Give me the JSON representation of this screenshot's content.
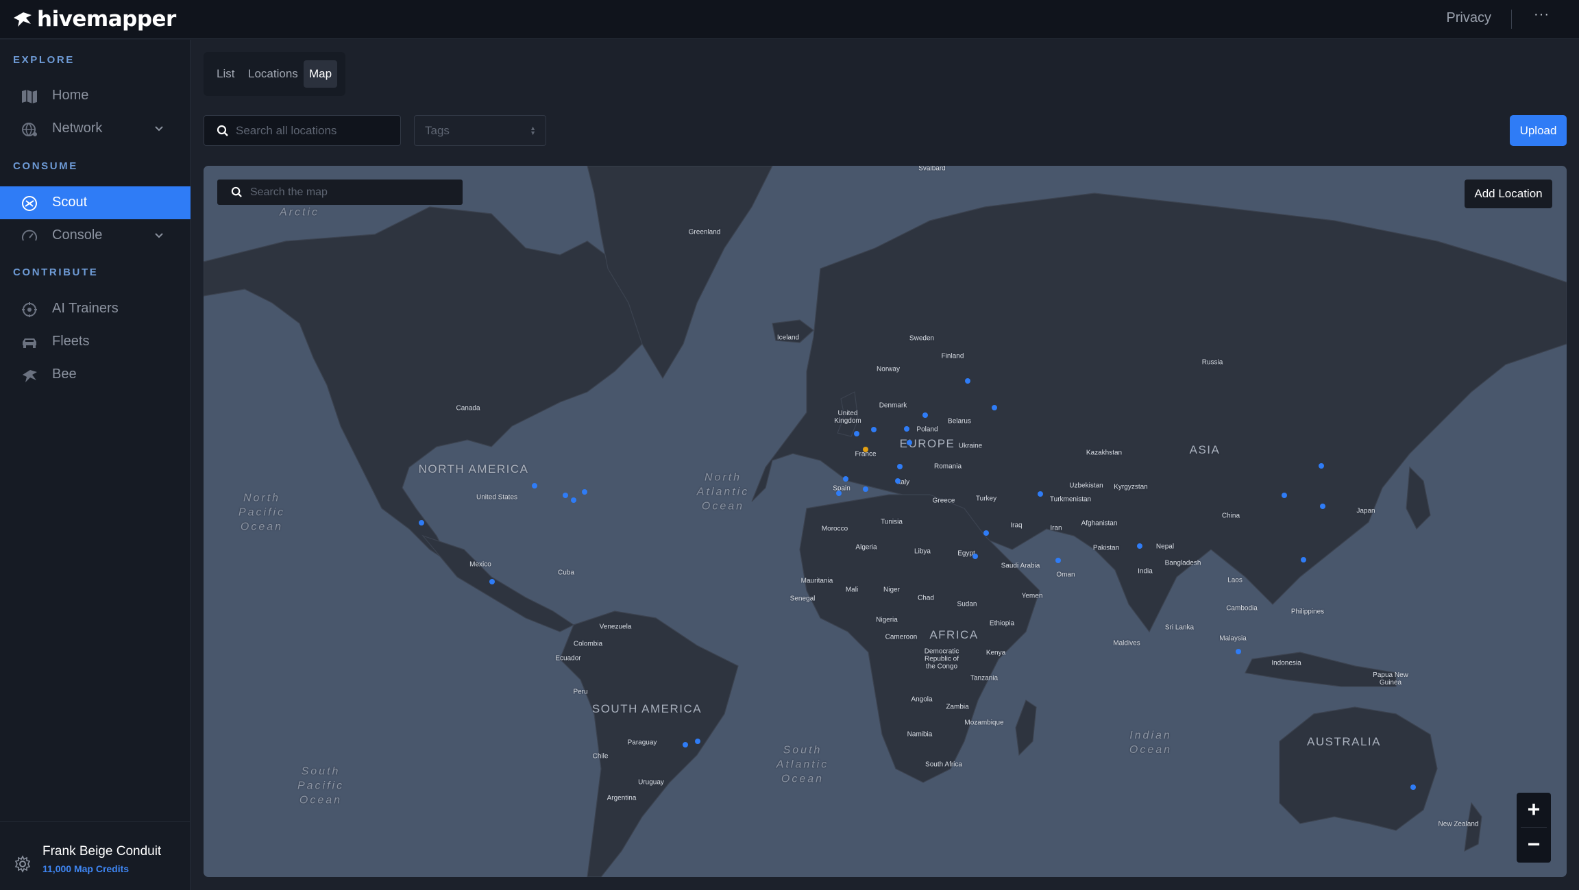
{
  "app": {
    "brand": "hivemapper"
  },
  "header": {
    "privacy_label": "Privacy",
    "more_label": "···"
  },
  "sidebar": {
    "sections": {
      "explore": "EXPLORE",
      "consume": "CONSUME",
      "contribute": "CONTRIBUTE"
    },
    "items": [
      {
        "label": "Home",
        "icon": "map-icon"
      },
      {
        "label": "Network",
        "icon": "globe-icon"
      },
      {
        "label": "Scout",
        "icon": "scout-icon",
        "active": true
      },
      {
        "label": "Console",
        "icon": "gauge-icon"
      },
      {
        "label": "AI Trainers",
        "icon": "ai-icon"
      },
      {
        "label": "Fleets",
        "icon": "car-icon"
      },
      {
        "label": "Bee",
        "icon": "bee-icon"
      }
    ],
    "user": {
      "name": "Frank Beige Conduit",
      "credits": "11,000 Map Credits"
    }
  },
  "main": {
    "tabs": [
      {
        "label": "List"
      },
      {
        "label": "Locations"
      },
      {
        "label": "Map",
        "active": true
      }
    ],
    "search_placeholder": "Search all locations",
    "tags_placeholder": "Tags",
    "upload_label": "Upload"
  },
  "map": {
    "search_placeholder": "Search the map",
    "add_location_label": "Add Location",
    "zoom_in": "+",
    "zoom_out": "−",
    "continents": [
      "NORTH\nAMERICA",
      "SOUTH\nAMERICA",
      "EUROPE",
      "AFRICA",
      "ASIA",
      "AUSTRALIA"
    ],
    "oceans": [
      "North\nPacific\nOcean",
      "North\nAtlantic\nOcean",
      "South\nAtlantic\nOcean",
      "Indian\nOcean",
      "South\nPacific\nOcean",
      "Arctic"
    ],
    "countries": [
      "Svalbard",
      "Greenland",
      "Iceland",
      "Canada",
      "United States",
      "Mexico",
      "Cuba",
      "Venezuela",
      "Colombia",
      "Ecuador",
      "Peru",
      "Chile",
      "Paraguay",
      "Uruguay",
      "Argentina",
      "Sweden",
      "Finland",
      "Norway",
      "Denmark",
      "United\nKingdom",
      "Poland",
      "Belarus",
      "Ukraine",
      "France",
      "Romania",
      "Spain",
      "Italy",
      "Greece",
      "Turkey",
      "Morocco",
      "Tunisia",
      "Algeria",
      "Libya",
      "Egypt",
      "Mauritania",
      "Mali",
      "Niger",
      "Chad",
      "Sudan",
      "Senegal",
      "Nigeria",
      "Ethiopia",
      "Cameroon",
      "Democratic\nRepublic of\nthe Congo",
      "Kenya",
      "Tanzania",
      "Angola",
      "Zambia",
      "Mozambique",
      "Namibia",
      "South Africa",
      "Russia",
      "Kazakhstan",
      "Uzbekistan",
      "Kyrgyzstan",
      "Turkmenistan",
      "Afghanistan",
      "Iraq",
      "Iran",
      "Saudi Arabia",
      "Yemen",
      "Oman",
      "Pakistan",
      "Nepal",
      "India",
      "Bangladesh",
      "China",
      "Japan",
      "Laos",
      "Cambodia",
      "Philippines",
      "Sri Lanka",
      "Maldives",
      "Malaysia",
      "Indonesia",
      "Papua New\nGuinea",
      "New Zealand"
    ],
    "accent_color": "#2f7cf6",
    "highlight_color": "#e3a012"
  }
}
